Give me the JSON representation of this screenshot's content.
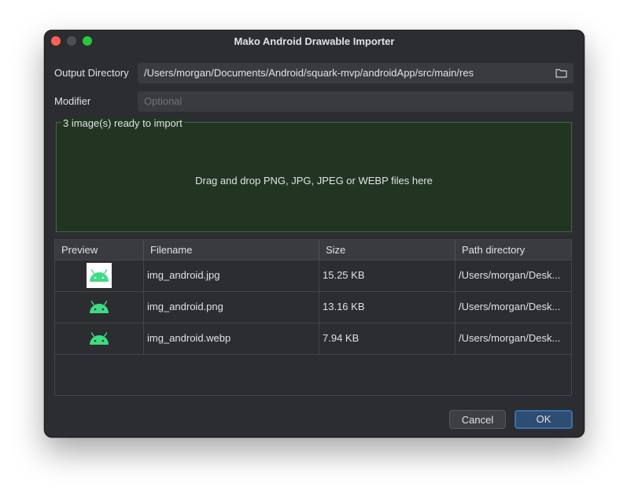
{
  "window": {
    "title": "Mako Android Drawable Importer"
  },
  "form": {
    "output_directory_label": "Output Directory",
    "output_directory_value": "/Users/morgan/Documents/Android/squark-mvp/androidApp/src/main/res",
    "modifier_label": "Modifier",
    "modifier_placeholder": "Optional"
  },
  "dropzone": {
    "status": "3 image(s) ready to import",
    "hint": "Drag and drop PNG, JPG, JPEG or WEBP files here"
  },
  "table": {
    "headers": [
      "Preview",
      "Filename",
      "Size",
      "Path directory"
    ],
    "rows": [
      {
        "preview": "android-icon",
        "filename": "img_android.jpg",
        "size": "15.25 KB",
        "path": "/Users/morgan/Desk..."
      },
      {
        "preview": "android-icon",
        "filename": "img_android.png",
        "size": "13.16 KB",
        "path": "/Users/morgan/Desk..."
      },
      {
        "preview": "android-icon",
        "filename": "img_android.webp",
        "size": "7.94 KB",
        "path": "/Users/morgan/Desk..."
      }
    ]
  },
  "buttons": {
    "cancel": "Cancel",
    "ok": "OK"
  },
  "colors": {
    "window_bg": "#2b2d30",
    "dropzone_bg": "#223523",
    "android_green": "#3ddc84",
    "accent": "#3d6ea8"
  }
}
